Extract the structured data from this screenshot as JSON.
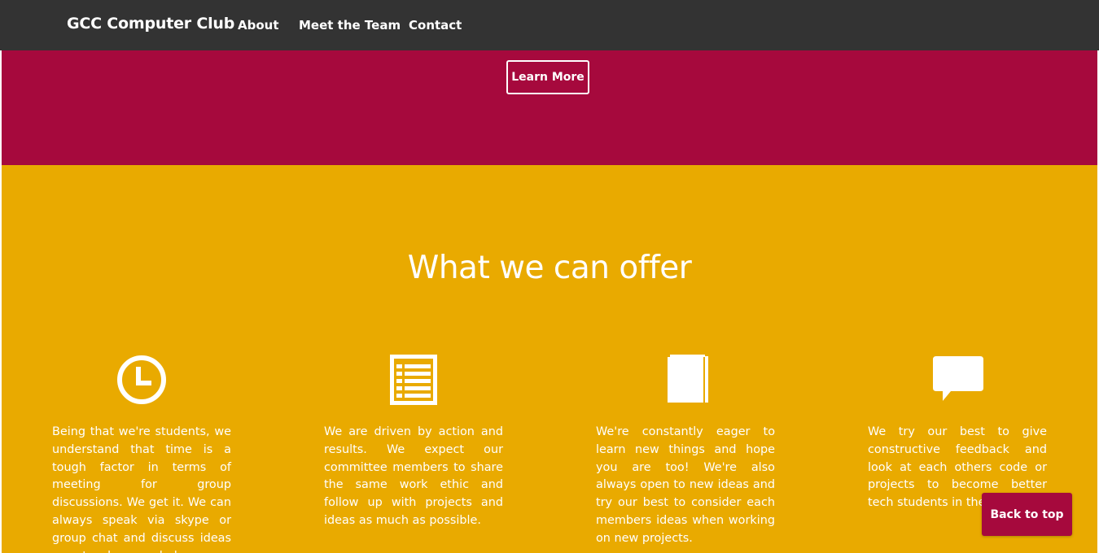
{
  "navbar": {
    "brand": "GCC Computer Club",
    "links": [
      "About",
      "Meet the Team",
      "Contact"
    ]
  },
  "hero": {
    "button_label": "Learn More"
  },
  "offer": {
    "title": "What we can offer",
    "features": [
      {
        "icon": "clock-icon",
        "text": "Being that we're students, we understand that time is a tough factor in terms of meeting for group discussions. We get it. We can always speak via skype or group chat and discuss ideas remote when needed."
      },
      {
        "icon": "list-icon",
        "text": "We are driven by action and results. We expect our committee members to share the same work ethic and follow up with projects and ideas as much as possible."
      },
      {
        "icon": "book-icon",
        "text": "We're constantly eager to learn new things and hope you are too! We're also always open to new ideas and try our best to consider each members ideas when working on new projects."
      },
      {
        "icon": "speech-bubble-icon",
        "text": "We try our best to give constructive feedback and look at each others code or projects to become better tech students in the long-run."
      }
    ]
  },
  "back_to_top": {
    "label": "Back to top"
  },
  "colors": {
    "navbar": "#333333",
    "hero": "#a6093d",
    "offer": "#e9aa00",
    "text": "#ffffff"
  }
}
